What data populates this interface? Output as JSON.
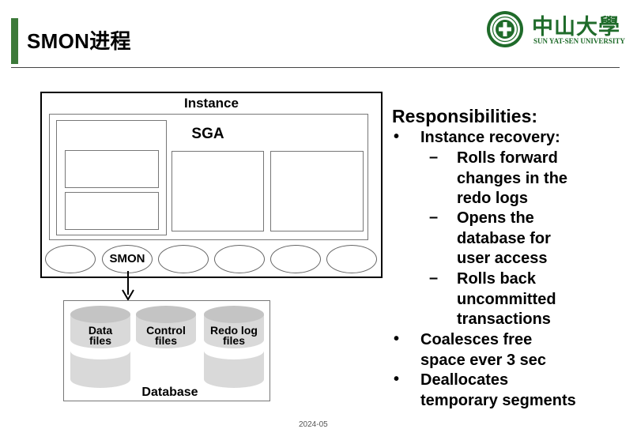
{
  "header": {
    "title": "SMON进程",
    "logo_name_cn": "中山大學",
    "logo_name_en": "SUN YAT-SEN UNIVERSITY",
    "accent_color": "#3d7a3a",
    "logo_color": "#1f6b2a"
  },
  "diagram": {
    "instance_label": "Instance",
    "sga_label": "SGA",
    "smon_label": "SMON",
    "database_label": "Database",
    "cylinders": [
      {
        "line1": "Data",
        "line2": "files"
      },
      {
        "line1": "Control",
        "line2": "files"
      },
      {
        "line1": "Redo log",
        "line2": "files"
      }
    ]
  },
  "responsibilities": {
    "heading": "Responsibilities:",
    "bullet_glyph": "•",
    "dash_glyph": "–",
    "items": [
      {
        "text_lines": [
          "Instance recovery:"
        ]
      },
      {
        "text_lines": [
          "Coalesces free",
          "space ever 3 sec"
        ]
      },
      {
        "text_lines": [
          "Deallocates",
          "temporary segments"
        ]
      }
    ],
    "sub_items": [
      {
        "text_lines": [
          "Rolls forward",
          "changes in the",
          "redo logs"
        ]
      },
      {
        "text_lines": [
          "Opens the",
          "database for",
          "user access"
        ]
      },
      {
        "text_lines": [
          "Rolls back",
          "uncommitted",
          "transactions"
        ]
      }
    ]
  },
  "footer": {
    "text": "2024-05"
  }
}
